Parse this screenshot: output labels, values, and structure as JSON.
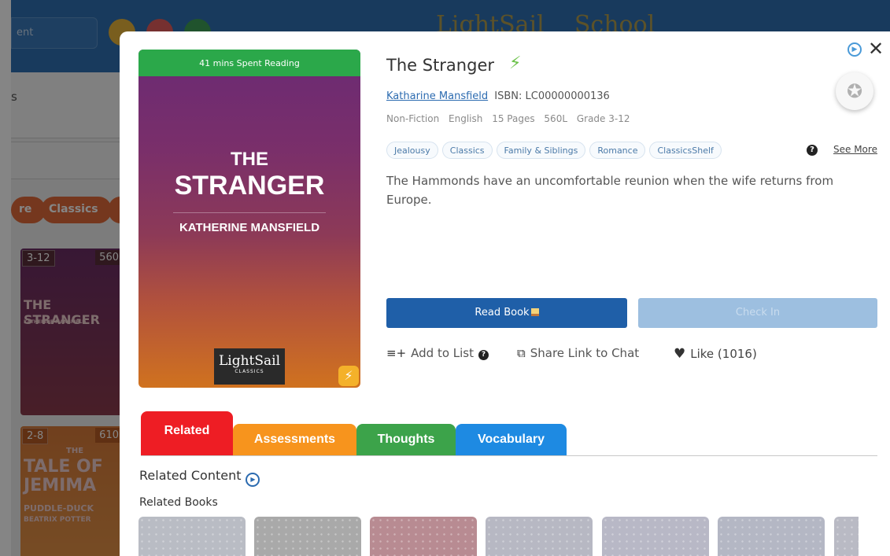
{
  "background": {
    "search_placeholder": "ent",
    "nav_label": "s",
    "genre_chips": [
      "re",
      "Classics"
    ],
    "books": [
      {
        "grade": "3-12",
        "lexile": "560",
        "title": "THE STRANGER",
        "author": "KATHERINE MANSFIELD"
      },
      {
        "grade": "2-8",
        "lexile": "610",
        "title_small": "THE",
        "title": "TALE OF JEMIMA",
        "subtitle": "PUDDLE-DUCK",
        "author": "BEATRIX POTTER"
      }
    ]
  },
  "book": {
    "title": "The Stranger",
    "time_spent": "41 mins Spent Reading",
    "cover_title_line1": "THE",
    "cover_title_line2": "STRANGER",
    "cover_author": "KATHERINE MANSFIELD",
    "publisher_name": "LightSail",
    "publisher_sub": "CLASSICS",
    "author": "Katharine Mansfield",
    "isbn": "ISBN: LC00000000136",
    "meta": [
      "Non-Fiction",
      "English",
      "15 Pages",
      "560L",
      "Grade 3-12"
    ],
    "tags": [
      "Jealousy",
      "Classics",
      "Family & Siblings",
      "Romance",
      "ClassicsShelf"
    ],
    "see_more": "See More",
    "description": "The Hammonds have an uncomfortable reunion when the wife returns from Europe."
  },
  "buttons": {
    "read_book": "Read Book",
    "check_in": "Check In"
  },
  "actions": {
    "add_to_list": "Add to List",
    "share_link": "Share Link to Chat",
    "like": "Like (1016)"
  },
  "tabs": [
    "Related",
    "Assessments",
    "Thoughts",
    "Vocabulary"
  ],
  "related": {
    "heading": "Related Content",
    "subheading": "Related Books",
    "thumb_colors": [
      "#b9bcc4",
      "#a9a9a9",
      "#b88b92",
      "#b7b8c3",
      "#b8b8c6",
      "#b4b7c4",
      "#b9bac4"
    ]
  },
  "colors": {
    "primary_blue": "#1f5fa8",
    "tab_related": "#ee1d24",
    "tab_assessments": "#f7941d",
    "tab_thoughts": "#3ca34a",
    "tab_vocabulary": "#1e8ae2",
    "progress_green": "#2ba84a"
  }
}
